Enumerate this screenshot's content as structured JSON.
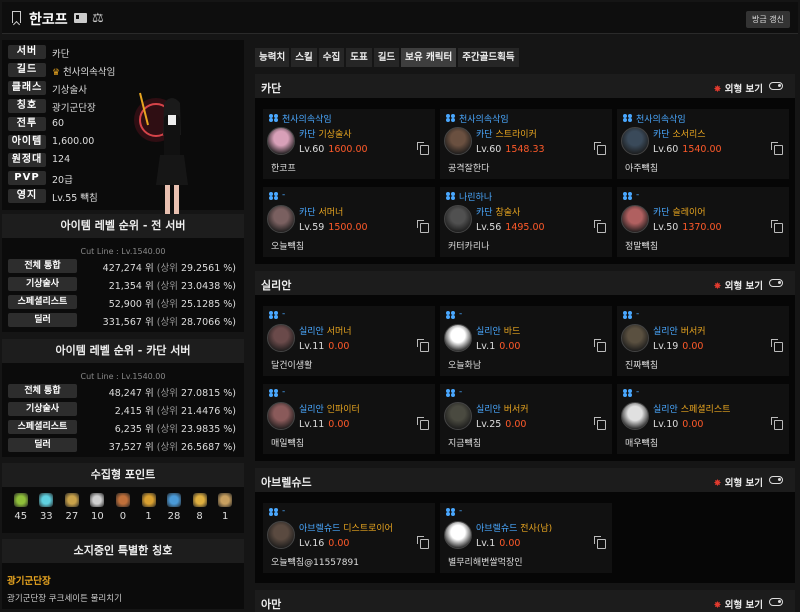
{
  "header": {
    "name": "한코프",
    "refresh": "방금 갱신"
  },
  "profile": [
    {
      "label": "서버",
      "value": "카단"
    },
    {
      "label": "길드",
      "value": "천사의속삭임",
      "crown": true
    },
    {
      "label": "클래스",
      "value": "기상술사"
    },
    {
      "label": "칭호",
      "value": "광기군단장"
    },
    {
      "label": "전투",
      "value": "60"
    },
    {
      "label": "아이템",
      "value": "1,600.00"
    },
    {
      "label": "원정대",
      "value": "124"
    },
    {
      "label": "PVP",
      "value": "20급"
    },
    {
      "label": "영지",
      "value": "Lv.55 빽침"
    }
  ],
  "rank_all": {
    "title": "아이템 레벨 순위 - 전 서버",
    "cutline": "Cut Line : Lv.1540.00",
    "rows": [
      {
        "label": "전체 통합",
        "rank": "427,274 위",
        "pct_label": "(상위",
        "pct": "29.2561 %)"
      },
      {
        "label": "기상술사",
        "rank": "21,354 위",
        "pct_label": "(상위",
        "pct": "23.0438 %)"
      },
      {
        "label": "스페셜리스트",
        "rank": "52,900 위",
        "pct_label": "(상위",
        "pct": "25.1285 %)"
      },
      {
        "label": "딜러",
        "rank": "331,567 위",
        "pct_label": "(상위",
        "pct": "28.7066 %)"
      }
    ]
  },
  "rank_server": {
    "title": "아이템 레벨 순위 - 카단 서버",
    "cutline": "Cut Line : Lv.1540.00",
    "rows": [
      {
        "label": "전체 통합",
        "rank": "48,247 위",
        "pct_label": "(상위",
        "pct": "27.0815 %)"
      },
      {
        "label": "기상술사",
        "rank": "2,415 위",
        "pct_label": "(상위",
        "pct": "21.4476 %)"
      },
      {
        "label": "스페셜리스트",
        "rank": "6,235 위",
        "pct_label": "(상위",
        "pct": "23.9835 %)"
      },
      {
        "label": "딜러",
        "rank": "37,527 위",
        "pct_label": "(상위",
        "pct": "26.5687 %)"
      }
    ]
  },
  "collect": {
    "title": "수집형 포인트",
    "items": [
      {
        "icon": "mokoko-seed-icon",
        "count": "45",
        "color": "#8fbf3a"
      },
      {
        "icon": "island-soul-icon",
        "count": "33",
        "color": "#5fd0e0"
      },
      {
        "icon": "great-art-icon",
        "count": "27",
        "color": "#c9a24a"
      },
      {
        "icon": "giant-heart-icon",
        "count": "10",
        "color": "#d0d0d0"
      },
      {
        "icon": "ignea-token-icon",
        "count": "0",
        "color": "#c0703a"
      },
      {
        "icon": "voyage-memory-icon",
        "count": "1",
        "color": "#d9a030"
      },
      {
        "icon": "world-tree-leaf-icon",
        "count": "28",
        "color": "#4a9ad8"
      },
      {
        "icon": "orpheus-star-icon",
        "count": "8",
        "color": "#e0b040"
      },
      {
        "icon": "sea-bounty-icon",
        "count": "1",
        "color": "#c8a060"
      }
    ]
  },
  "title_panel": {
    "title": "소지중인 특별한 칭호",
    "name": "광기군단장",
    "desc": "광기군단장 쿠크세이튼 물리치기"
  },
  "tabs": [
    "능력치",
    "스킬",
    "수집",
    "도표",
    "길드",
    "보유 캐릭터",
    "주간골드획득"
  ],
  "view_label": "외형 보기",
  "servers": [
    {
      "name": "카단",
      "chars": [
        {
          "guild": "천사의속삭임",
          "server": "카단",
          "cls": "기상술사",
          "lv": "Lv.60",
          "il": "1600.00",
          "cname": "한코프",
          "av": "#d8a0b8"
        },
        {
          "guild": "천사의속삭임",
          "server": "카단",
          "cls": "스트라이커",
          "lv": "Lv.60",
          "il": "1548.33",
          "cname": "공격잘한다",
          "av": "#6a5040"
        },
        {
          "guild": "천사의속삭임",
          "server": "카단",
          "cls": "소서리스",
          "lv": "Lv.60",
          "il": "1540.00",
          "cname": "아주빽침",
          "av": "#3a4a5a"
        },
        {
          "guild": "-",
          "server": "카단",
          "cls": "서머너",
          "lv": "Lv.59",
          "il": "1500.00",
          "cname": "오늘빽침",
          "av": "#7a6060"
        },
        {
          "guild": "나린하나",
          "server": "카단",
          "cls": "창술사",
          "lv": "Lv.56",
          "il": "1495.00",
          "cname": "커터카리나",
          "av": "#505050"
        },
        {
          "guild": "-",
          "server": "카단",
          "cls": "슬레이어",
          "lv": "Lv.50",
          "il": "1370.00",
          "cname": "정말빽침",
          "av": "#b06060"
        }
      ]
    },
    {
      "name": "실리안",
      "chars": [
        {
          "guild": "-",
          "server": "실리안",
          "cls": "서머너",
          "lv": "Lv.11",
          "il": "0.00",
          "cname": "달건이생활",
          "av": "#6a4a4a"
        },
        {
          "guild": "-",
          "server": "실리안",
          "cls": "바드",
          "lv": "Lv.1",
          "il": "0.00",
          "cname": "오늘화남",
          "av": "#ffffff"
        },
        {
          "guild": "-",
          "server": "실리안",
          "cls": "버서커",
          "lv": "Lv.19",
          "il": "0.00",
          "cname": "진짜빽침",
          "av": "#5a5040"
        },
        {
          "guild": "-",
          "server": "실리안",
          "cls": "인파이터",
          "lv": "Lv.11",
          "il": "0.00",
          "cname": "매일빽침",
          "av": "#8a5a5a"
        },
        {
          "guild": "-",
          "server": "실리안",
          "cls": "버서커",
          "lv": "Lv.25",
          "il": "0.00",
          "cname": "지금빽침",
          "av": "#4a4a40"
        },
        {
          "guild": "-",
          "server": "실리안",
          "cls": "스페셜리스트",
          "lv": "Lv.10",
          "il": "0.00",
          "cname": "매우빽침",
          "av": "#e0e0e0"
        }
      ]
    },
    {
      "name": "아브렐슈드",
      "chars": [
        {
          "guild": "-",
          "server": "아브렐슈드",
          "cls": "디스트로이어",
          "lv": "Lv.16",
          "il": "0.00",
          "cname": "오늘빽침@11557891",
          "av": "#5a4a40"
        },
        {
          "guild": "-",
          "server": "아브렐슈드",
          "cls": "전사(남)",
          "lv": "Lv.1",
          "il": "0.00",
          "cname": "별무리해변쌀먹장인",
          "av": "#ffffff"
        }
      ]
    },
    {
      "name": "아만",
      "chars": []
    }
  ]
}
